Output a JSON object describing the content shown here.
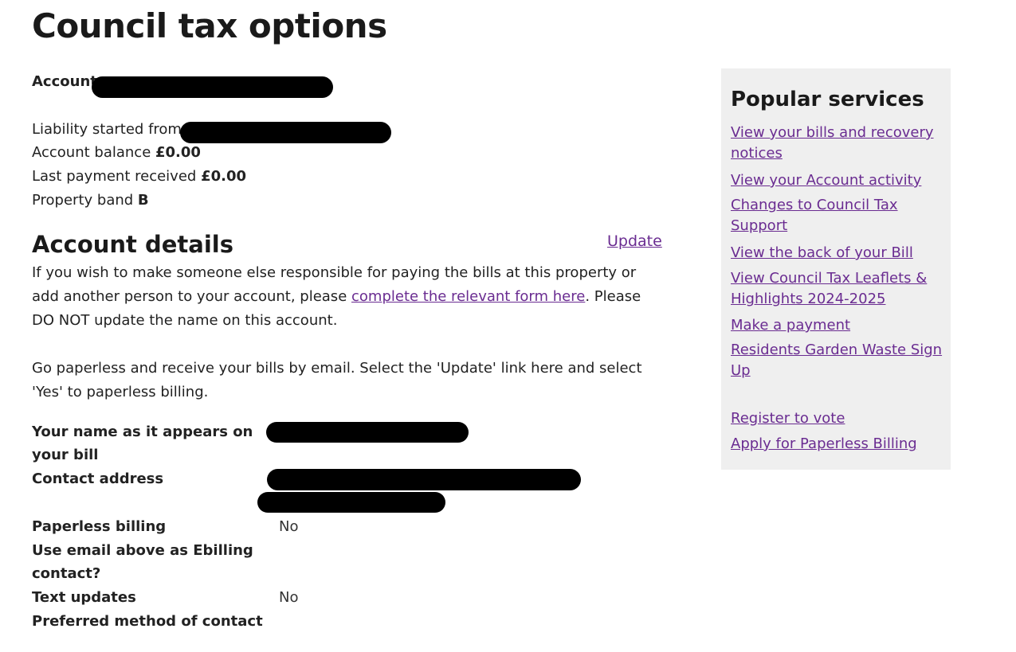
{
  "page": {
    "title": "Council tax options",
    "account_label": "Account",
    "liability_label": "Liability started from",
    "balance_label": "Account balance",
    "balance_value": "£0.00",
    "last_payment_label": "Last payment received",
    "last_payment_value": "£0.00",
    "band_label": "Property band",
    "band_value": "B"
  },
  "details": {
    "heading": "Account details",
    "update_link": "Update",
    "para1_before": "If you wish to make someone else responsible for paying the bills at this property or add another person to your account, please",
    "para1_link": "complete the relevant form here",
    "para1_after": ". Please DO NOT update the name on this account.",
    "para2": "Go paperless and receive your bills by email. Select the 'Update' link here and select 'Yes' to paperless billing.",
    "fields": {
      "name_label": "Your name as it appears on your bill",
      "address_label": "Contact address",
      "paperless_label": "Paperless billing",
      "paperless_value": "No",
      "email_label": "Use email above as Ebilling contact?",
      "text_label": "Text updates",
      "text_value": "No",
      "contact_label": "Preferred method of contact"
    }
  },
  "sidebar": {
    "title": "Popular services",
    "links": [
      "View your bills and recovery notices",
      "View your Account activity",
      "Changes to Council Tax Support",
      "View the back of your Bill",
      "View Council Tax Leaflets & Highlights 2024-2025",
      "Make a payment",
      "Residents Garden Waste Sign Up",
      "Register to vote",
      "Apply for Paperless Billing"
    ]
  },
  "colors": {
    "link": "#6a2c91",
    "sidebar_bg": "#efefef",
    "redaction": "#000000"
  }
}
